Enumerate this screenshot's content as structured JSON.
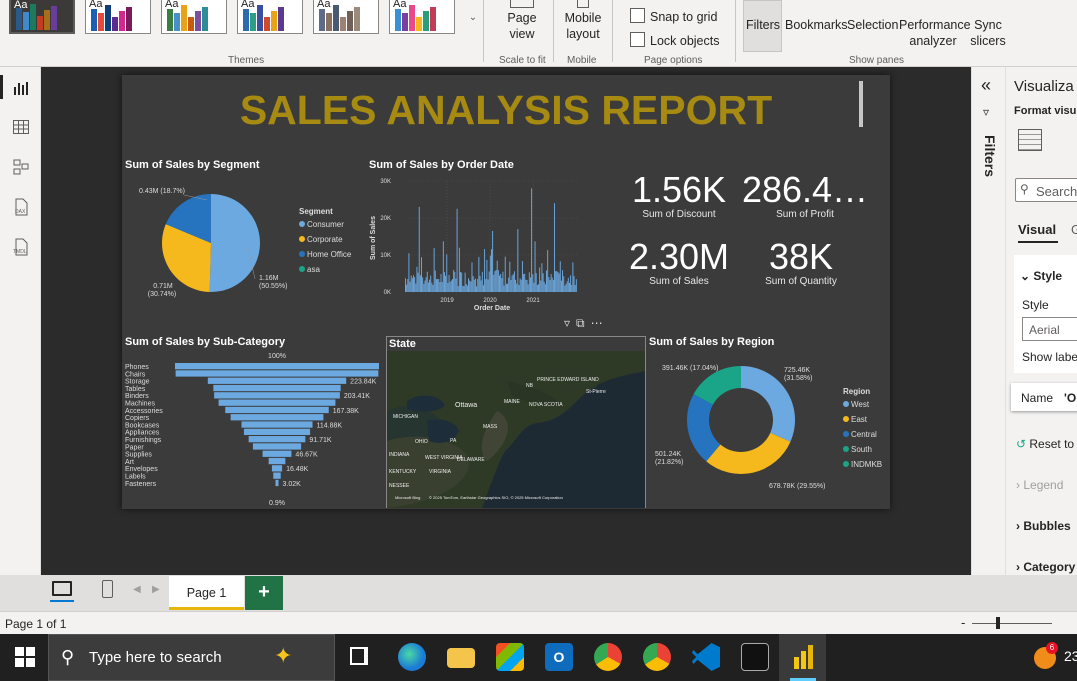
{
  "ribbon": {
    "themes_label": "Themes",
    "theme_aa": "Aa",
    "page_view": "Page view",
    "scale_to_fit": "Scale to fit",
    "mobile_layout": "Mobile layout",
    "mobile": "Mobile",
    "snap_to_grid": "Snap to grid",
    "lock_objects": "Lock objects",
    "page_options": "Page options",
    "filters": "Filters",
    "bookmarks": "Bookmarks",
    "selection": "Selection",
    "performance_analyzer": "Performance analyzer",
    "sync_slicers": "Sync slicers",
    "show_panes": "Show panes"
  },
  "report": {
    "title": "SALES ANALYSIS REPORT",
    "segment_chart": {
      "title": "Sum of Sales by Segment",
      "legend_title": "Segment",
      "legend": [
        "Consumer",
        "Corporate",
        "Home Office",
        "asa"
      ],
      "labels": [
        "0.43M (18.7%)",
        "0.71M (30.74%)",
        "1.16M (50.55%)"
      ]
    },
    "date_chart": {
      "title": "Sum of Sales by Order Date",
      "ylabel": "Sum of Sales",
      "xlabel": "Order Date",
      "yticks": [
        "30K",
        "20K",
        "10K",
        "0K"
      ],
      "xticks": [
        "2019",
        "2020",
        "2021"
      ]
    },
    "kpis": [
      {
        "value": "1.56K",
        "label": "Sum of Discount"
      },
      {
        "value": "286.4…",
        "label": "Sum of Profit"
      },
      {
        "value": "2.30M",
        "label": "Sum of Sales"
      },
      {
        "value": "38K",
        "label": "Sum of Quantity"
      }
    ],
    "subcat_chart": {
      "title": "Sum of Sales by Sub-Category",
      "top_pct": "100%",
      "bottom_pct": "0.9%",
      "categories": [
        "Phones",
        "Chairs",
        "Storage",
        "Tables",
        "Binders",
        "Machines",
        "Accessories",
        "Copiers",
        "Bookcases",
        "Appliances",
        "Furnishings",
        "Paper",
        "Supplies",
        "Art",
        "Envelopes",
        "Labels",
        "Fasteners"
      ],
      "value_labels": [
        "223.84K",
        "203.41K",
        "167.38K",
        "114.88K",
        "91.71K",
        "46.67K",
        "16.48K",
        "3.02K"
      ]
    },
    "map": {
      "title": "State",
      "credits": "© 2025 TomTom, Earthstar Geographics SIO, © 2025 Microsoft Corporation",
      "places": [
        "PRINCE EDWARD ISLAND",
        "NB",
        "MAINE",
        "St-Pierre",
        "Ottawa",
        "NOVA SCOTIA",
        "MICHIGAN",
        "MASS",
        "OHIO",
        "PA",
        "WEST VIRGINIA",
        "INDIANA",
        "DELAWARE",
        "KENTUCKY",
        "VIRGINIA",
        "NESSEE"
      ],
      "logo": "Microsoft Bing"
    },
    "region_chart": {
      "title": "Sum of Sales by Region",
      "legend_title": "Region",
      "legend": [
        "West",
        "East",
        "Central",
        "South",
        "INDMKB"
      ],
      "labels": [
        "391.46K (17.04%)",
        "725.46K (31.58%)",
        "501.24K (21.82%)",
        "678.78K (29.55%)"
      ]
    }
  },
  "filters_pane": {
    "label": "Filters"
  },
  "viz_pane": {
    "title": "Visualiza",
    "format": "Format visu",
    "search": "Search",
    "tab_visual": "Visual",
    "tab_g": "G",
    "style_section": "Style",
    "style_label": "Style",
    "style_value": "Aerial",
    "show_labels": "Show label",
    "name_label": "Name",
    "name_value": "'O",
    "reset": "Reset to",
    "legend": "Legend",
    "bubbles": "Bubbles",
    "category": "Category"
  },
  "pages": {
    "tab": "Page 1",
    "status": "Page 1 of 1",
    "zoom_minus": "-"
  },
  "taskbar": {
    "search_placeholder": "Type here to search",
    "badge": "6",
    "clock": "23"
  },
  "colors": {
    "title_gold": "#a68a12",
    "series_blue_light": "#6ca9e0",
    "series_blue_dark": "#2673c0",
    "series_yellow": "#f5b81d",
    "series_teal": "#1aa589",
    "canvas": "#2b2b2b",
    "card": "#3b3b3b"
  },
  "chart_data": [
    {
      "type": "pie",
      "title": "Sum of Sales by Segment",
      "categories": [
        "Consumer",
        "Corporate",
        "Home Office"
      ],
      "values": [
        1.16,
        0.71,
        0.43
      ],
      "unit": "M",
      "percents": [
        50.55,
        30.74,
        18.7
      ]
    },
    {
      "type": "bar",
      "title": "Sum of Sales by Order Date",
      "xlabel": "Order Date",
      "ylabel": "Sum of Sales",
      "ylim": [
        0,
        30000
      ],
      "x_range": [
        "2018-01",
        "2021-12"
      ]
    },
    {
      "type": "bar",
      "title": "Sum of Sales by Sub-Category",
      "categories": [
        "Phones",
        "Chairs",
        "Storage",
        "Tables",
        "Binders",
        "Machines",
        "Accessories",
        "Copiers",
        "Bookcases",
        "Appliances",
        "Furnishings",
        "Paper",
        "Supplies",
        "Art",
        "Envelopes",
        "Labels",
        "Fasteners"
      ],
      "values": [
        330000,
        328000,
        223840,
        206000,
        203410,
        189000,
        167380,
        150000,
        114880,
        107000,
        91710,
        78000,
        46670,
        27000,
        16480,
        12000,
        3020
      ]
    },
    {
      "type": "pie",
      "title": "Sum of Sales by Region",
      "categories": [
        "West",
        "East",
        "Central",
        "South"
      ],
      "values": [
        725.46,
        678.78,
        501.24,
        391.46
      ],
      "unit": "K",
      "percents": [
        31.58,
        29.55,
        21.82,
        17.04
      ]
    }
  ]
}
